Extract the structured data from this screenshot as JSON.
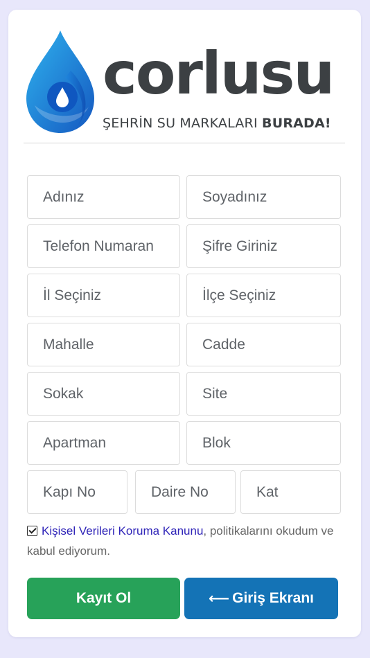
{
  "brand": {
    "name": "corlusu",
    "tagline_prefix": "ŞEHRİN SU MARKALARI",
    "tagline_bold": "BURADA!",
    "colors": {
      "drop_light": "#2aa7e6",
      "drop_dark": "#1560c4",
      "text": "#3c4043"
    }
  },
  "form": {
    "first_name": "Adınız",
    "last_name": "Soyadınız",
    "phone": "Telefon Numaran",
    "password": "Şifre Giriniz",
    "province": "İl Seçiniz",
    "district": "İlçe Seçiniz",
    "neighborhood": "Mahalle",
    "avenue": "Cadde",
    "street": "Sokak",
    "site": "Site",
    "apartment": "Apartman",
    "block": "Blok",
    "door_no": "Kapı No",
    "flat_no": "Daire No",
    "floor": "Kat"
  },
  "consent": {
    "checked": true,
    "link_text": "Kişisel Verileri Koruma Kanunu",
    "text_after": ", politikalarını okudum ve kabul ediyorum."
  },
  "buttons": {
    "register": "Kayıt Ol",
    "login_arrow": "⟵",
    "login": "Giriş Ekranı"
  },
  "colors": {
    "background": "#e8e7fb",
    "register_button": "#27a259",
    "login_button": "#1473b6",
    "link": "#2f24b8"
  }
}
